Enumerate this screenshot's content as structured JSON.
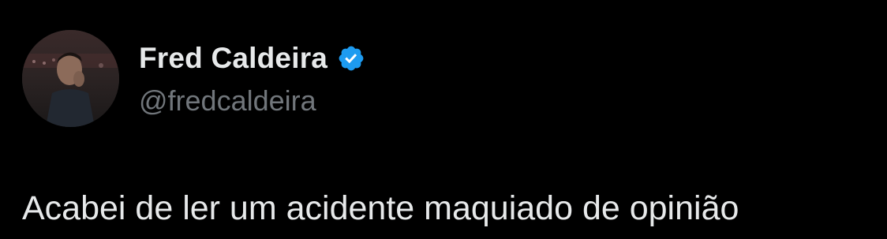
{
  "tweet": {
    "author": {
      "display_name": "Fred Caldeira",
      "handle": "@fredcaldeira",
      "verified": true,
      "verified_icon": "verified-badge-icon",
      "avatar": "profile-photo"
    },
    "text": "Acabei de ler um acidente maquiado de opinião"
  },
  "colors": {
    "background": "#000000",
    "name": "#e7e9ea",
    "handle": "#71767b",
    "verified_badge": "#1d9bf0"
  }
}
